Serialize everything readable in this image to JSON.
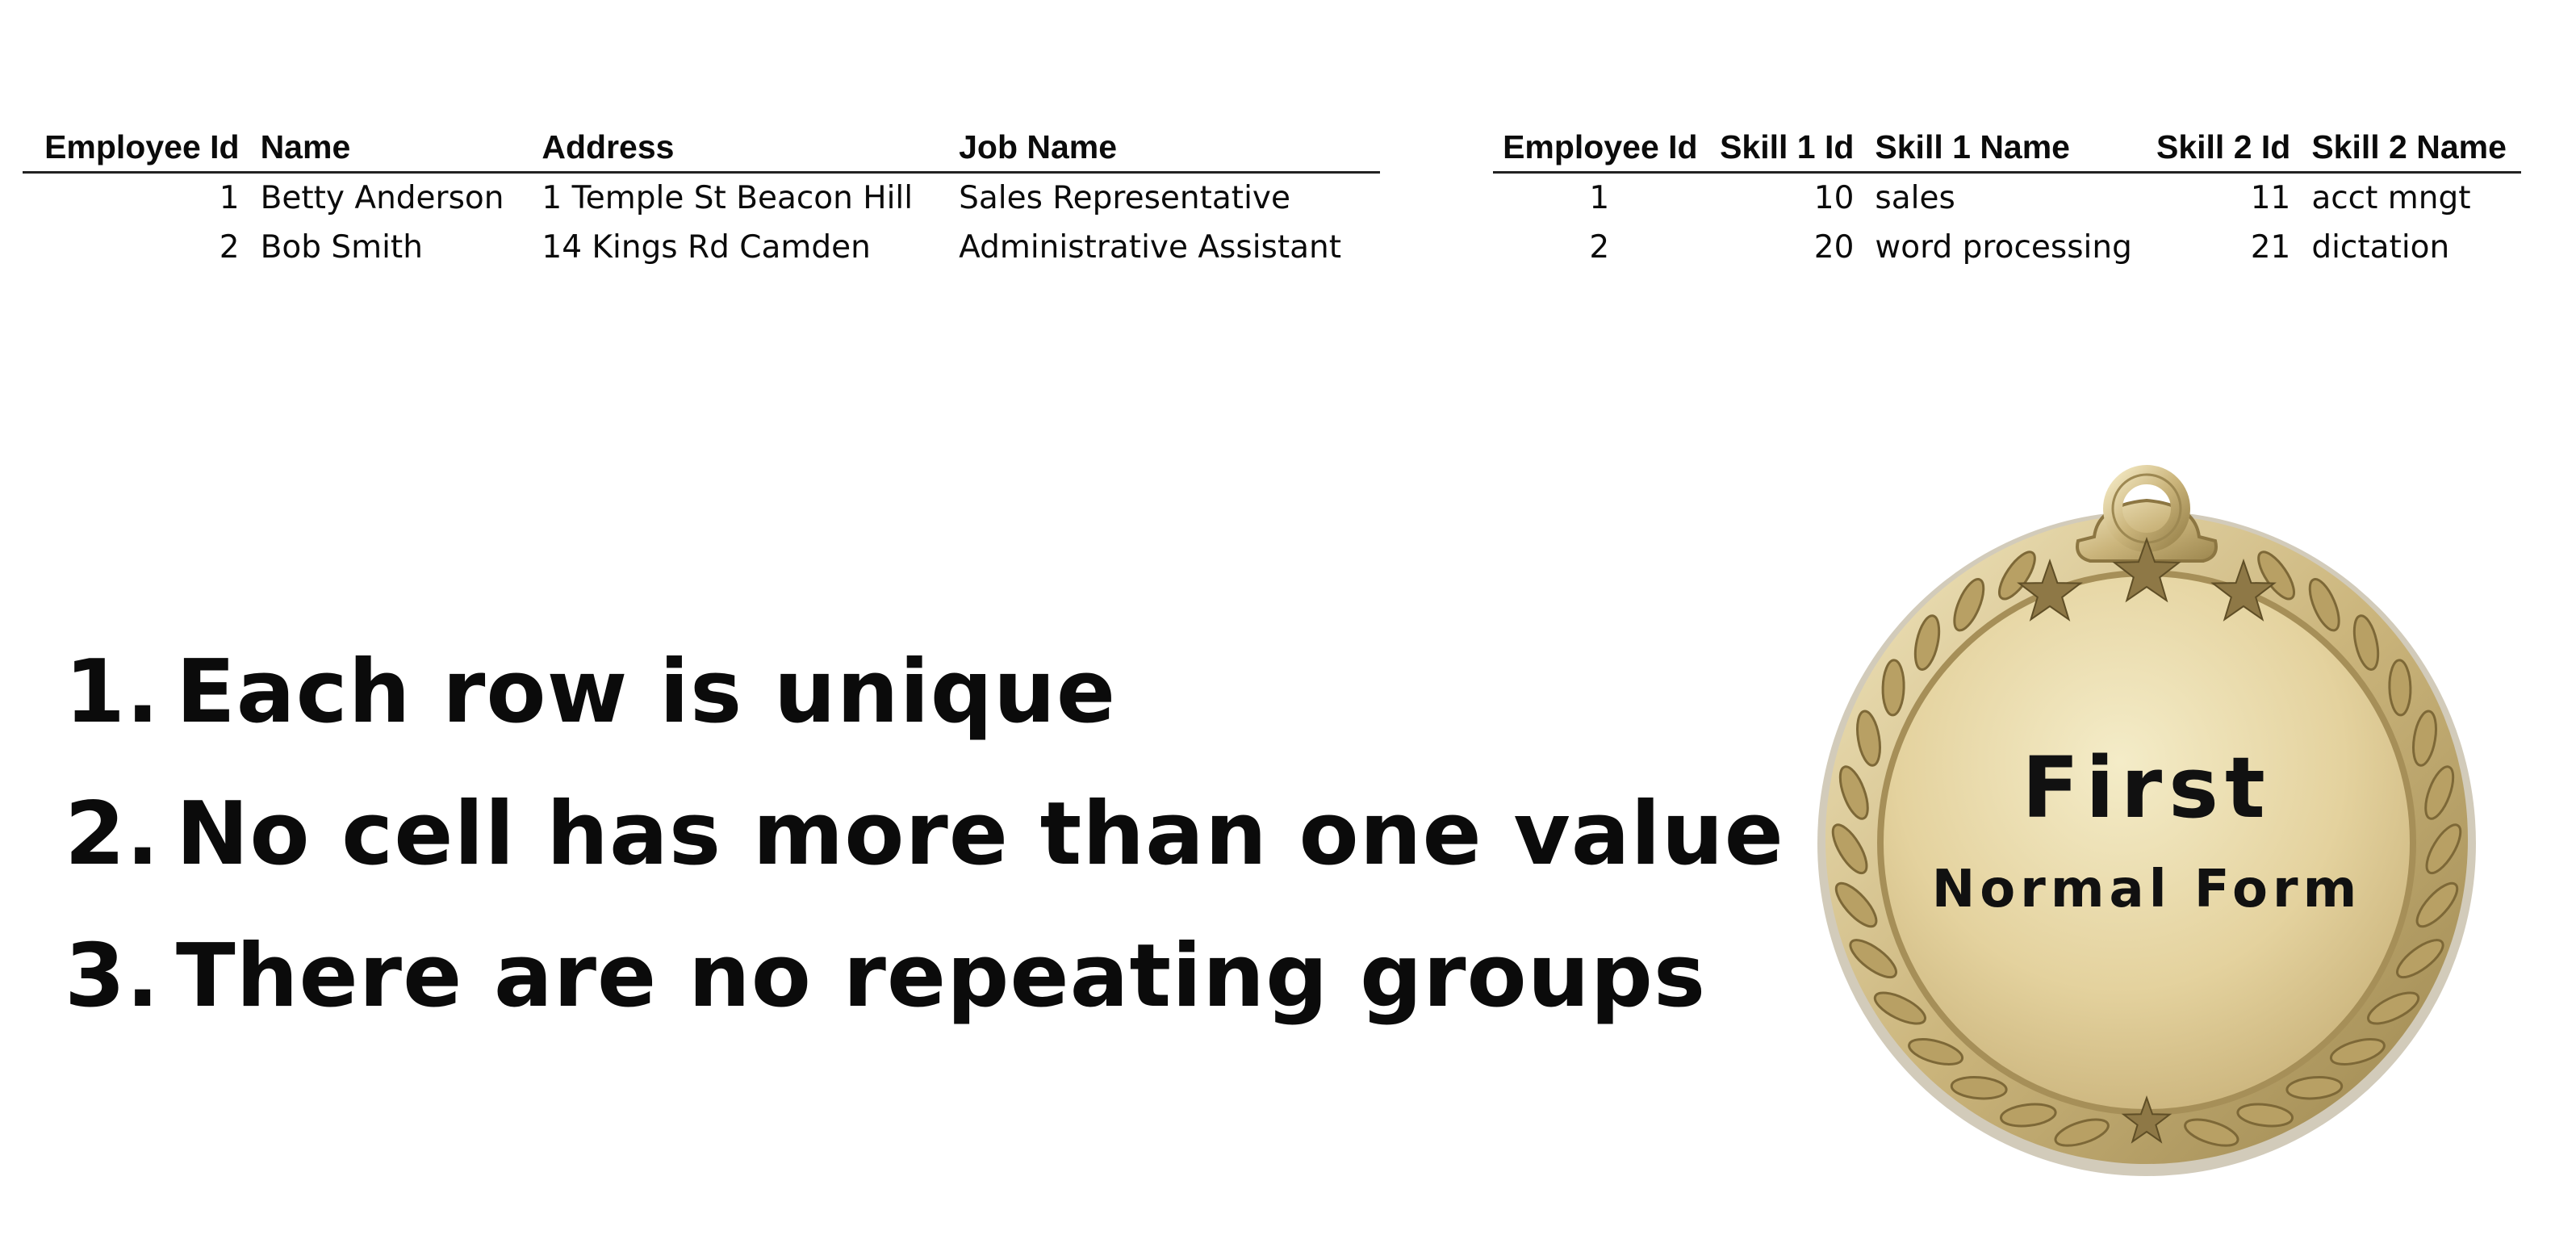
{
  "employee_table": {
    "headers": [
      "Employee Id",
      "Name",
      "Address",
      "Job Name"
    ],
    "rows": [
      [
        "1",
        "Betty Anderson",
        "1 Temple St Beacon Hill",
        "Sales Representative"
      ],
      [
        "2",
        "Bob Smith",
        "14 Kings Rd Camden",
        "Administrative Assistant"
      ]
    ]
  },
  "skill_table": {
    "headers": [
      "Employee Id",
      "Skill 1 Id",
      "Skill 1 Name",
      "Skill 2 Id",
      "Skill 2 Name"
    ],
    "rows": [
      [
        "1",
        "10",
        "sales",
        "11",
        "acct mngt"
      ],
      [
        "2",
        "20",
        "word processing",
        "21",
        "dictation"
      ]
    ]
  },
  "rules": [
    {
      "number": "1.",
      "text": "Each row is unique"
    },
    {
      "number": "2.",
      "text": "No cell has more than one value"
    },
    {
      "number": "3.",
      "text": "There are no repeating groups"
    }
  ],
  "medal": {
    "line1": "First",
    "line2": "Normal Form",
    "colors": {
      "gold_light": "#efe3b6",
      "gold_mid": "#d2bd84",
      "gold_dark": "#8c7642"
    }
  }
}
